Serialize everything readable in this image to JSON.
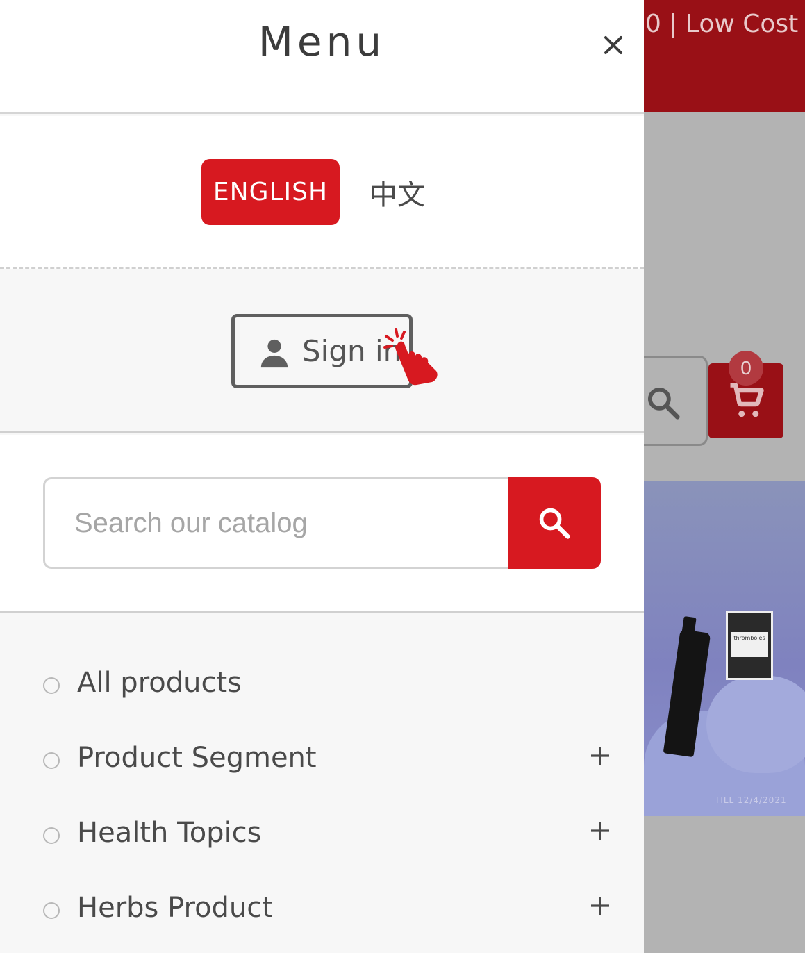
{
  "background": {
    "topbar_text": "0 | Low Cost",
    "cart_count": "0",
    "banner_box_text": "thromboles",
    "banner_till_text": "TILL 12/4/2021",
    "colors": {
      "topbar": "#991016",
      "overlay_gray": "#b3b3b3"
    }
  },
  "menu": {
    "title": "Menu",
    "close_icon": "close-icon",
    "languages": {
      "english": "ENGLISH",
      "chinese": "中文",
      "active": "ENGLISH"
    },
    "signin_label": "Sign in",
    "search": {
      "placeholder": "Search our catalog",
      "value": ""
    },
    "nav_items": [
      {
        "label": "All products",
        "expandable": false
      },
      {
        "label": "Product Segment",
        "expandable": true
      },
      {
        "label": "Health Topics",
        "expandable": true
      },
      {
        "label": "Herbs Product",
        "expandable": true
      }
    ],
    "colors": {
      "accent": "#d71920",
      "text": "#4a4a4a"
    }
  }
}
